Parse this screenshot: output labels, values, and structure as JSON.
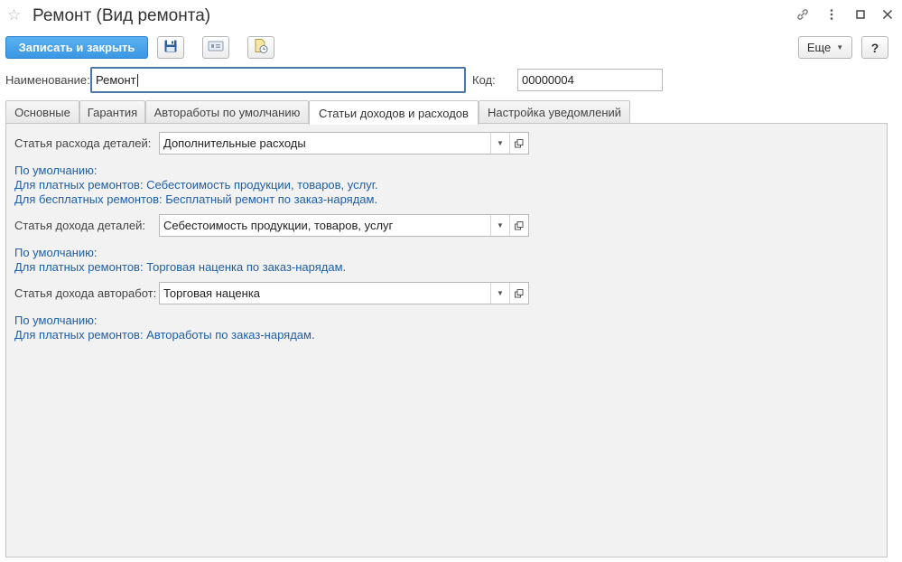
{
  "window": {
    "title": "Ремонт (Вид ремонта)"
  },
  "toolbar": {
    "save_close_label": "Записать и закрыть",
    "more_label": "Еще",
    "help_label": "?"
  },
  "fields": {
    "name_label": "Наименование:",
    "name_value": "Ремонт",
    "code_label": "Код:",
    "code_value": "00000004"
  },
  "tabs": [
    {
      "label": "Основные",
      "active": false
    },
    {
      "label": "Гарантия",
      "active": false
    },
    {
      "label": "Автоработы по умолчанию",
      "active": false
    },
    {
      "label": "Статьи доходов и расходов",
      "active": true
    },
    {
      "label": "Настройка уведомлений",
      "active": false
    }
  ],
  "panel": {
    "parts_expense": {
      "label": "Статья расхода деталей:",
      "value": "Дополнительные расходы",
      "hint": [
        "По умолчанию:",
        "Для платных ремонтов: Себестоимость продукции, товаров, услуг.",
        "Для бесплатных ремонтов: Бесплатный ремонт по заказ-нарядам."
      ]
    },
    "parts_income": {
      "label": "Статья дохода деталей:",
      "value": "Себестоимость продукции, товаров, услуг",
      "hint": [
        "По умолчанию:",
        "Для платных ремонтов: Торговая наценка по заказ-нарядам."
      ]
    },
    "works_income": {
      "label": "Статья дохода авторабот:",
      "value": "Торговая наценка",
      "hint": [
        "По умолчанию:",
        "Для платных ремонтов: Автоработы по заказ-нарядам."
      ]
    }
  },
  "colors": {
    "primary_button": "#3c97e3",
    "hint_text": "#1f5fa8",
    "focus_border": "#4a79a8"
  }
}
